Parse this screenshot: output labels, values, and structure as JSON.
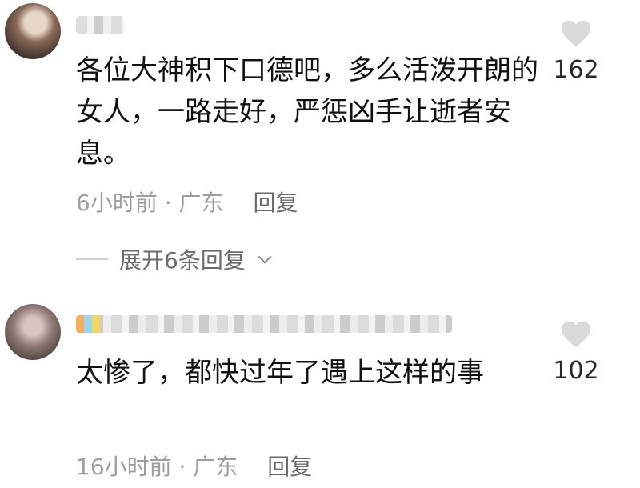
{
  "comments": [
    {
      "text": "各位大神积下口德吧，多么活泼开朗的女人，一路走好，严惩凶手让逝者安息。",
      "time": "6小时前",
      "separator": "·",
      "location": "广东",
      "reply_label": "回复",
      "likes": "162",
      "expand_label": "展开6条回复"
    },
    {
      "text": "太惨了，都快过年了遇上这样的事",
      "time": "16小时前",
      "separator": "·",
      "location": "广东",
      "reply_label": "回复",
      "likes": "102"
    }
  ],
  "icons": {
    "like": "heart-icon",
    "expand": "chevron-down-icon"
  },
  "colors": {
    "text": "#111111",
    "meta": "#9e9e9e",
    "heart": "#d9d9d9"
  }
}
